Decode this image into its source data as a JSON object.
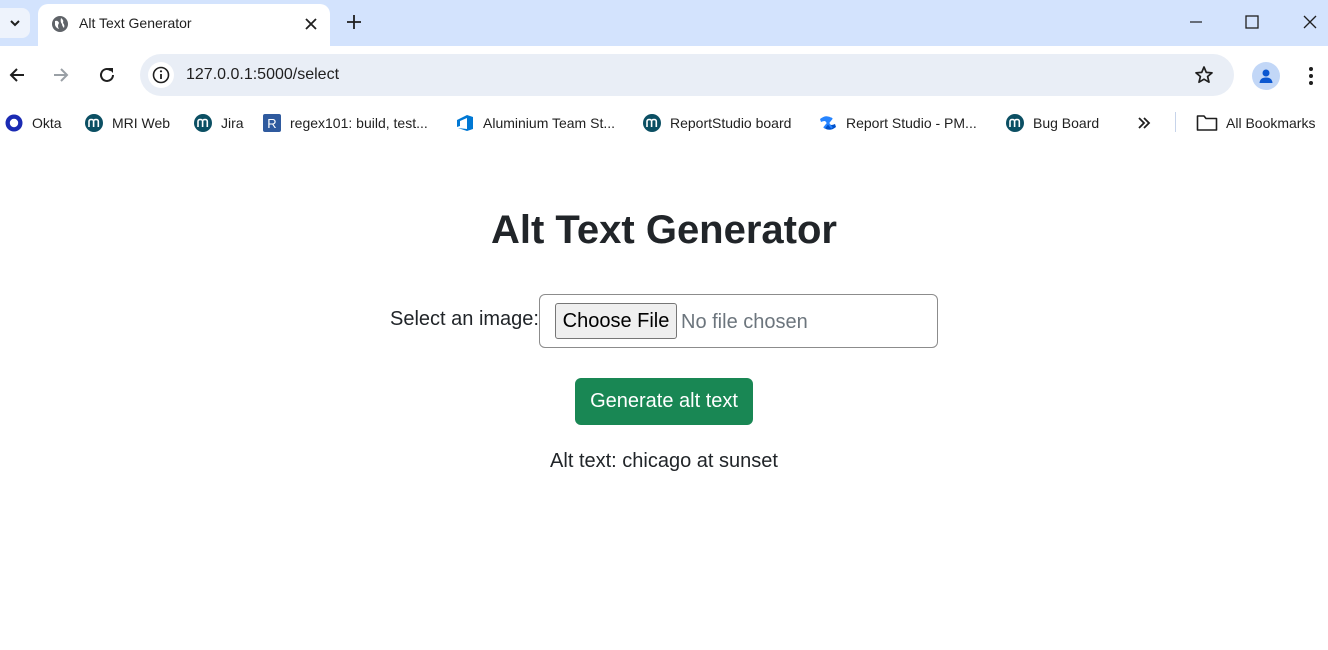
{
  "browser": {
    "tab": {
      "title": "Alt Text Generator"
    },
    "address": {
      "url": "127.0.0.1:5000/select"
    },
    "icons": {
      "tab_search": "chevron-down-icon",
      "favicon": "globe-icon",
      "tab_close": "close-icon",
      "new_tab": "plus-icon",
      "minimize": "minimize-icon",
      "maximize": "maximize-icon",
      "close": "close-icon",
      "back": "arrow-left-icon",
      "forward": "arrow-right-icon",
      "reload": "reload-icon",
      "site_info": "info-icon",
      "bookmark_star": "star-icon",
      "profile": "person-icon",
      "menu": "more-vertical-icon"
    },
    "bookmarks": [
      {
        "label": "Okta",
        "icon": "okta-icon"
      },
      {
        "label": "MRI Web",
        "icon": "mri-icon"
      },
      {
        "label": "Jira",
        "icon": "mri-icon"
      },
      {
        "label": "regex101: build, test...",
        "icon": "regex101-icon"
      },
      {
        "label": "Aluminium Team St...",
        "icon": "azure-devops-icon"
      },
      {
        "label": "ReportStudio board",
        "icon": "mri-icon"
      },
      {
        "label": "Report Studio - PM...",
        "icon": "confluence-icon"
      },
      {
        "label": "Bug Board",
        "icon": "mri-icon"
      }
    ],
    "overflow_icon": "chevron-double-right-icon",
    "all_bookmarks": {
      "label": "All Bookmarks",
      "icon": "folder-icon"
    }
  },
  "page": {
    "title": "Alt Text Generator",
    "form": {
      "label": "Select an image:",
      "choose_button": "Choose File",
      "file_status": "No file chosen",
      "submit_button": "Generate alt text"
    },
    "result": "Alt text: chicago at sunset"
  },
  "colors": {
    "tabstrip": "#d3e3fd",
    "omnibox": "#e9eef6",
    "primary_button": "#198754",
    "mri_brand": "#0b4f63"
  }
}
